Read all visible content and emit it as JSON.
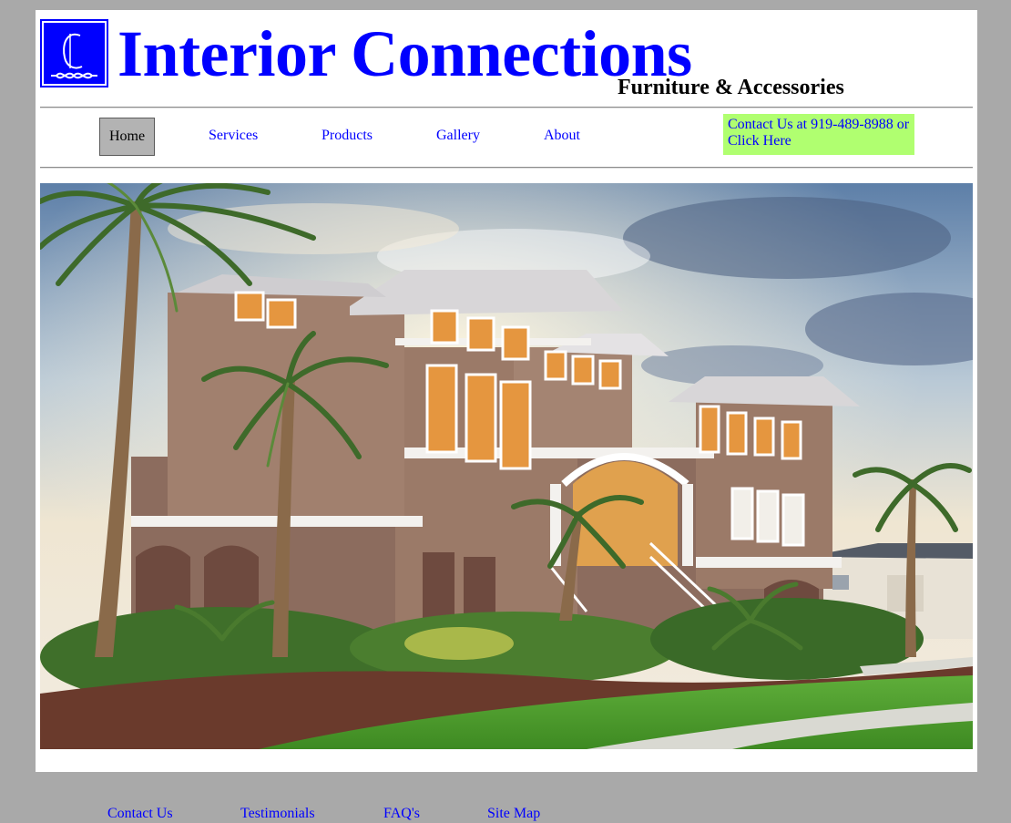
{
  "header": {
    "logo_name": "interior-connections-logo",
    "title": "Interior Connections",
    "tagline": "Furniture & Accessories"
  },
  "nav": {
    "items": [
      {
        "label": "Home",
        "active": true
      },
      {
        "label": "Services"
      },
      {
        "label": "Products"
      },
      {
        "label": "Gallery"
      },
      {
        "label": "About"
      }
    ],
    "contact_line1": "Contact Us at 919-489-8988 or",
    "contact_line2": "Click Here"
  },
  "hero": {
    "image_name": "beach-house-photo"
  },
  "footer": {
    "links": [
      {
        "label": "Contact Us"
      },
      {
        "label": "Testimonials"
      },
      {
        "label": "FAQ's"
      },
      {
        "label": "Site Map"
      }
    ]
  },
  "colors": {
    "background": "#a9a9a9",
    "link": "#0000ff",
    "contact_box": "#b0ff70",
    "active_tab": "#b3b3b3"
  }
}
